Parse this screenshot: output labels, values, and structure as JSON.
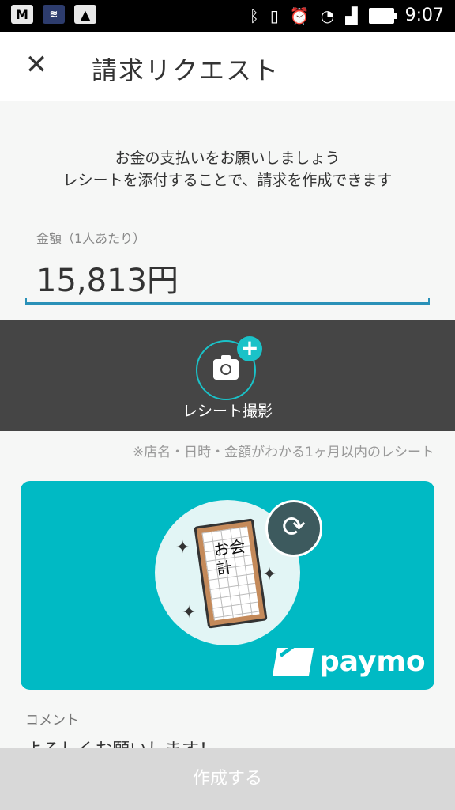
{
  "status_bar": {
    "time": "9:07",
    "gmail_icon_text": "M"
  },
  "header": {
    "title": "請求リクエスト"
  },
  "intro": {
    "line1": "お金の支払いをお願いしましょう",
    "line2": "レシートを添付することで、請求を作成できます"
  },
  "amount_field": {
    "label": "金額（1人あたり）",
    "value": "15,813円"
  },
  "camera": {
    "label": "レシート撮影"
  },
  "receipt_hint": "※店名・日時・金額がわかる1ヶ月以内のレシート",
  "receipt_card": {
    "illustration_text": "お会計",
    "brand": "paymo",
    "background": "#00bac4"
  },
  "comment": {
    "label": "コメント",
    "value": "よろしくお願いします！"
  },
  "submit_button": {
    "label": "作成する"
  },
  "colors": {
    "accent": "#1ac2c8",
    "underline": "#2a91b8",
    "dark_band": "#454545"
  }
}
